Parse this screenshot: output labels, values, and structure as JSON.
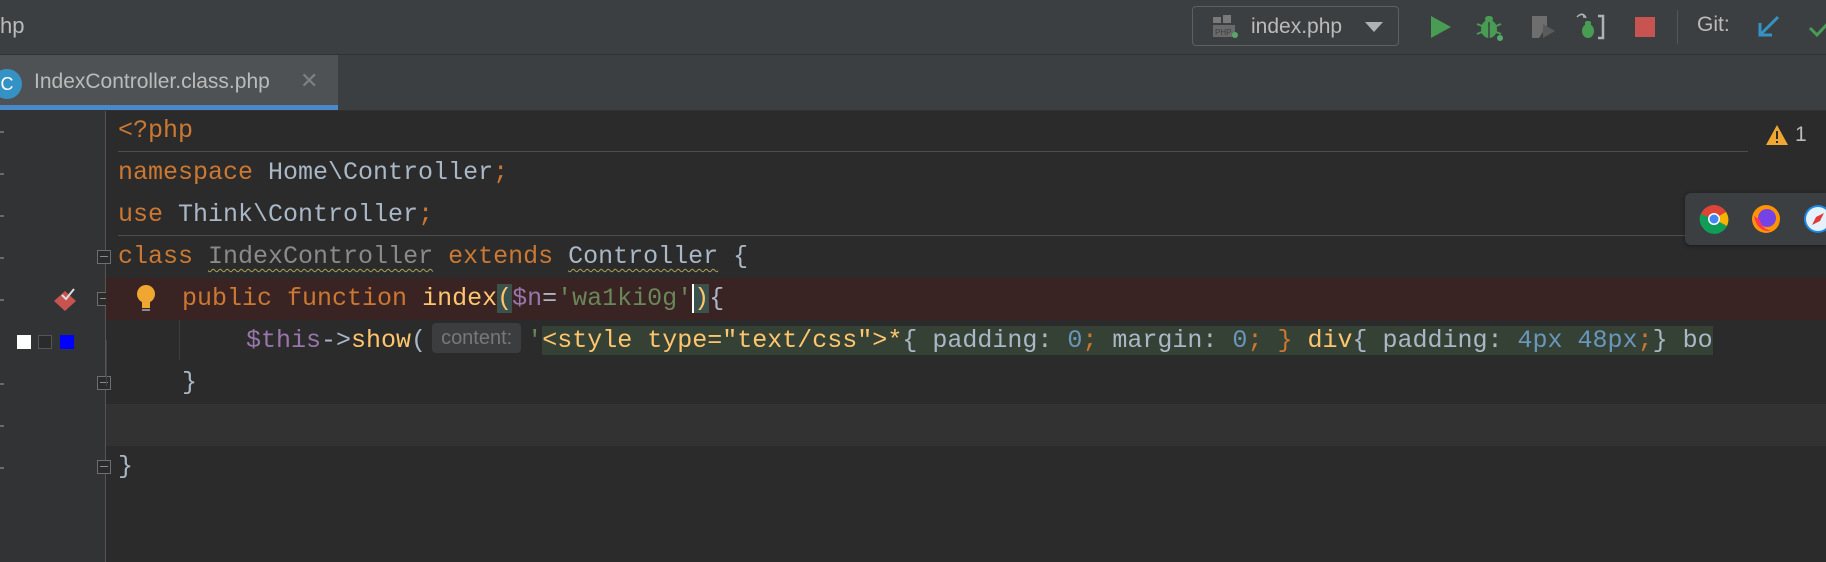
{
  "toolbar": {
    "project_name": "hp",
    "run_config": "index.php",
    "git_label": "Git:"
  },
  "tabs": [
    {
      "icon": "C",
      "title": "IndexController.class.php",
      "close": "✕"
    }
  ],
  "inspection": {
    "warning_count": "1"
  },
  "code": {
    "line1": {
      "open_tag": "<?php"
    },
    "line2": {
      "kw": "namespace",
      "name": " Home\\Controller",
      "semi": ";"
    },
    "line3": {
      "kw": "use",
      "name": " Think\\Controller",
      "semi": ";"
    },
    "line4": {
      "kw_class": "class",
      "class_name": "IndexController",
      "kw_extends": "extends",
      "parent": "Controller",
      "brace": " {"
    },
    "line5": {
      "kw_public": "public",
      "kw_function": "function",
      "fn_name": "index",
      "paren_open": "(",
      "var": "$n",
      "eq": "=",
      "str": "'wa1ki0g'",
      "paren_close": ")",
      "brace": "{"
    },
    "line6": {
      "this": "$this",
      "arrow": "->",
      "method": "show",
      "paren": "(",
      "hint": "content:",
      "quote": "'",
      "tag_open": "<style type=\"text/css\">",
      "star": "*",
      "css1": "{ padding: ",
      "zero1": "0",
      "semi1": "; ",
      "margin": "margin: ",
      "zero2": "0",
      "semi2": "; } ",
      "div": "div",
      "css2": "{ padding: ",
      "px4": "4px",
      "sp": " ",
      "px48": "48px",
      "semi3": ";",
      "tail": "} bo"
    },
    "line7": {
      "brace": "}"
    },
    "line9": {
      "brace": "}"
    }
  },
  "colors": {
    "editor_bg": "#2b2b2b",
    "keyword": "#cc7832",
    "function": "#ffc66d",
    "variable": "#9876aa",
    "string": "#6a8759",
    "number": "#6897bb",
    "accent": "#4a88c7",
    "breakpoint_line": "#3a2323"
  },
  "icons": {
    "run": "run-icon",
    "debug": "debug-icon",
    "coverage": "coverage-icon",
    "attach": "attach-debugger-icon",
    "stop": "stop-icon",
    "git_update": "git-update-icon",
    "git_commit": "git-commit-icon",
    "browsers": [
      "chrome-icon",
      "firefox-icon",
      "safari-icon"
    ]
  }
}
